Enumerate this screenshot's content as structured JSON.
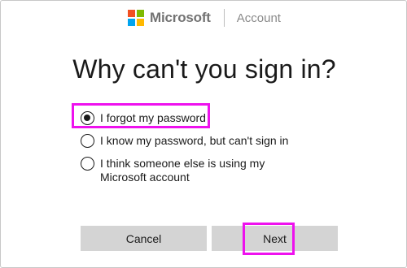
{
  "header": {
    "brand": "Microsoft",
    "section": "Account",
    "logo_colors": [
      "#f25022",
      "#7fba00",
      "#00a4ef",
      "#ffb900"
    ]
  },
  "title": "Why can't you sign in?",
  "options": [
    {
      "label": "I forgot my password",
      "selected": true
    },
    {
      "label": "I know my password, but can't sign in",
      "selected": false
    },
    {
      "label": "I think someone else is using my Microsoft account",
      "selected": false
    }
  ],
  "buttons": {
    "cancel": "Cancel",
    "next": "Next"
  },
  "highlight_color": "#ee11ee"
}
